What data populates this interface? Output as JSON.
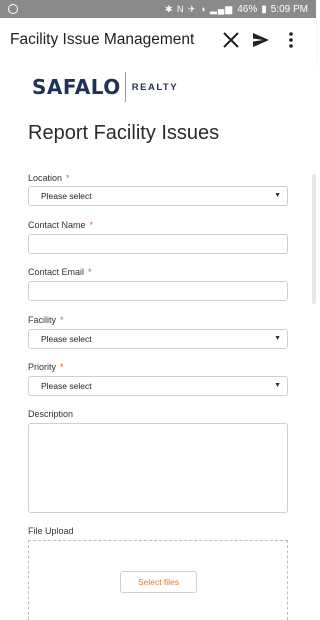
{
  "status_bar": {
    "icons": "✱ N ✈ ◑ ▂▄▆",
    "battery": "46%",
    "time": "5:09 PM"
  },
  "app_bar": {
    "title": "Facility Issue Management",
    "close_icon": "close-icon",
    "send_icon": "send-icon",
    "more_icon": "more-vert-icon"
  },
  "logo": {
    "brand": "SAFALO",
    "sub": "REALTY"
  },
  "form": {
    "title": "Report Facility Issues",
    "location_label": "Location",
    "location_value": "Please select",
    "contact_name_label": "Contact Name",
    "contact_email_label": "Contact Email",
    "facility_label": "Facility",
    "facility_value": "Please select",
    "priority_label": "Priority",
    "priority_value": "Please select",
    "description_label": "Description",
    "file_upload_label": "File Upload",
    "select_files_label": "Select files",
    "required_mark": "*"
  },
  "colors": {
    "brand": "#1f3158",
    "accent": "#e07a2e",
    "required": "#e0601f"
  }
}
